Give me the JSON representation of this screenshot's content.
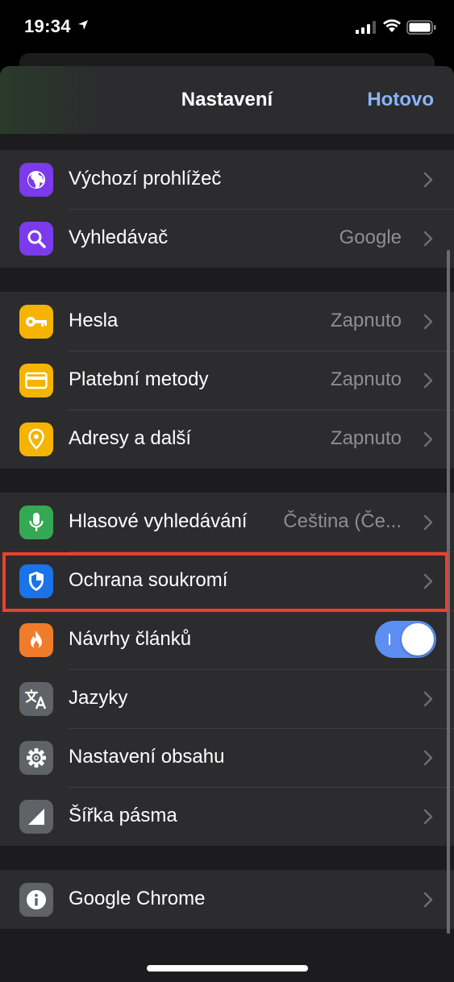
{
  "status_bar": {
    "time": "19:34"
  },
  "header": {
    "title": "Nastavení",
    "done_label": "Hotovo"
  },
  "groups": [
    {
      "items": [
        {
          "label": "Výchozí prohlížeč",
          "value": "",
          "icon": "globe-icon",
          "icon_color": "#7c3aed"
        },
        {
          "label": "Vyhledávač",
          "value": "Google",
          "icon": "search-icon",
          "icon_color": "#7c3aed"
        }
      ]
    },
    {
      "items": [
        {
          "label": "Hesla",
          "value": "Zapnuto",
          "icon": "key-icon",
          "icon_color": "#f4b400"
        },
        {
          "label": "Platební metody",
          "value": "Zapnuto",
          "icon": "credit-card-icon",
          "icon_color": "#f4b400"
        },
        {
          "label": "Adresy a další",
          "value": "Zapnuto",
          "icon": "location-pin-icon",
          "icon_color": "#f4b400"
        }
      ]
    },
    {
      "items": [
        {
          "label": "Hlasové vyhledávání",
          "value": "Čeština (Če...",
          "icon": "microphone-icon",
          "icon_color": "#34a853"
        },
        {
          "label": "Ochrana soukromí",
          "value": "",
          "icon": "shield-icon",
          "icon_color": "#1a73e8",
          "highlighted": true
        },
        {
          "label": "Návrhy článků",
          "value": "",
          "icon": "fire-icon",
          "icon_color": "#f07b2a",
          "toggle": true
        },
        {
          "label": "Jazyky",
          "value": "",
          "icon": "translate-icon",
          "icon_color": "#5f6368"
        },
        {
          "label": "Nastavení obsahu",
          "value": "",
          "icon": "gear-icon",
          "icon_color": "#5f6368"
        },
        {
          "label": "Šířka pásma",
          "value": "",
          "icon": "signal-bars-icon",
          "icon_color": "#5f6368"
        }
      ]
    },
    {
      "items": [
        {
          "label": "Google Chrome",
          "value": "",
          "icon": "info-icon",
          "icon_color": "#5f6368"
        }
      ]
    }
  ],
  "colors": {
    "accent": "#8ab4f8",
    "toggle_on": "#5d8ff2",
    "highlight": "#e8412c"
  }
}
